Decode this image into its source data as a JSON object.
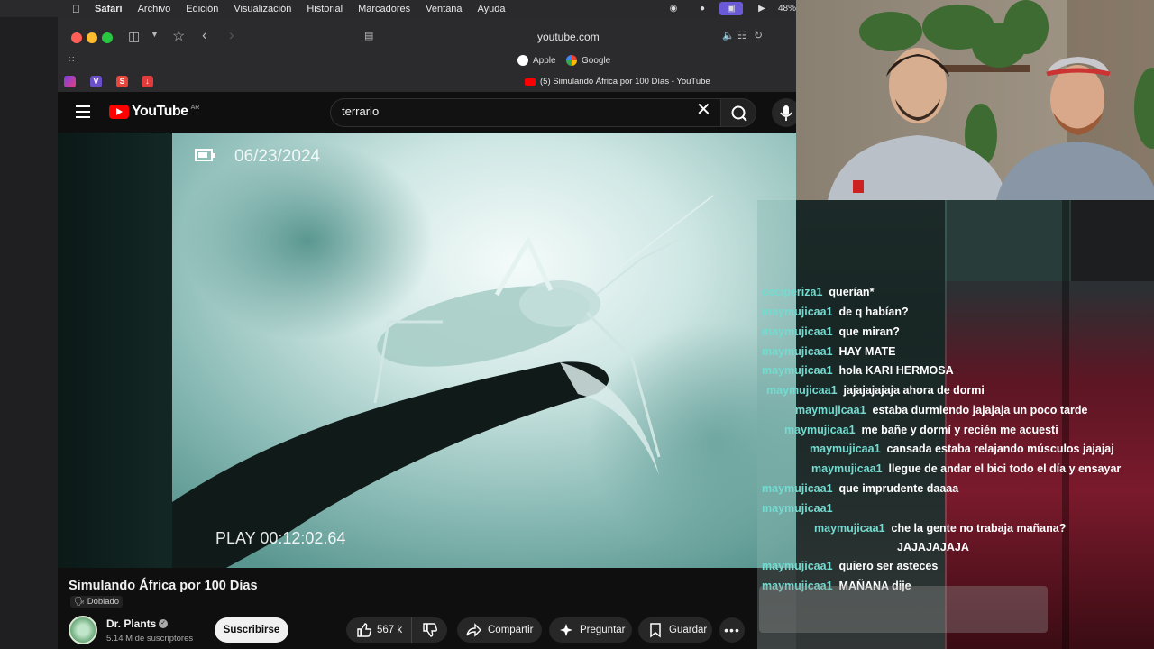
{
  "menubar": {
    "app": "Safari",
    "items": [
      "Archivo",
      "Edición",
      "Visualización",
      "Historial",
      "Marcadores",
      "Ventana",
      "Ayuda"
    ],
    "battery": "48%"
  },
  "browser": {
    "url": "youtube.com",
    "favorites": [
      "Apple",
      "Google"
    ],
    "extensions": [
      "V",
      "S"
    ],
    "tab_title": "(5) Simulando África por 100 Días - YouTube"
  },
  "youtube": {
    "logo_text": "YouTube",
    "country": "AR",
    "search_query": "terrario",
    "video": {
      "date_overlay": "06/23/2024",
      "play_overlay": "PLAY 00:12:02.64",
      "title": "Simulando África por 100 Días",
      "dub_badge": "Doblado",
      "channel": "Dr. Plants",
      "subscribers": "5.14 M de suscriptores",
      "subscribe_label": "Suscribirse",
      "likes": "567 k",
      "share_label": "Compartir",
      "ask_label": "Preguntar",
      "save_label": "Guardar"
    }
  },
  "chat": {
    "messages": [
      {
        "user": "ceciperiza1",
        "text": "querían*"
      },
      {
        "user": "maymujicaa1",
        "text": "de q habían?"
      },
      {
        "user": "maymujicaa1",
        "text": "que miran?"
      },
      {
        "user": "maymujicaa1",
        "text": "HAY MATE"
      },
      {
        "user": "maymujicaa1",
        "text": "hola KARI HERMOSA"
      },
      {
        "user": "maymujicaa1",
        "text": "jajajajajaja ahora de dormi"
      },
      {
        "user": "maymujicaa1",
        "text": "estaba durmiendo jajajaja un poco tarde"
      },
      {
        "user": "maymujicaa1",
        "text": "me bañe y dormí y recién me acuesti"
      },
      {
        "user": "maymujicaa1",
        "text": "cansada estaba relajando músculos jajajaj"
      },
      {
        "user": "maymujicaa1",
        "text": "llegue de andar el bici todo el día y ensayar"
      },
      {
        "user": "maymujicaa1",
        "text": "que imprudente daaaa"
      },
      {
        "user": "maymujicaa1",
        "text": ""
      },
      {
        "user": "maymujicaa1",
        "text": "che la gente no trabaja mañana?"
      },
      {
        "user": "",
        "text": "JAJAJAJAJA"
      },
      {
        "user": "maymujicaa1",
        "text": "quiero ser asteces"
      },
      {
        "user": "maymujicaa1",
        "text": "MAÑANA dije"
      }
    ]
  },
  "colors": {
    "youtube_red": "#ff0000",
    "chat_username": "#73dbd0"
  }
}
